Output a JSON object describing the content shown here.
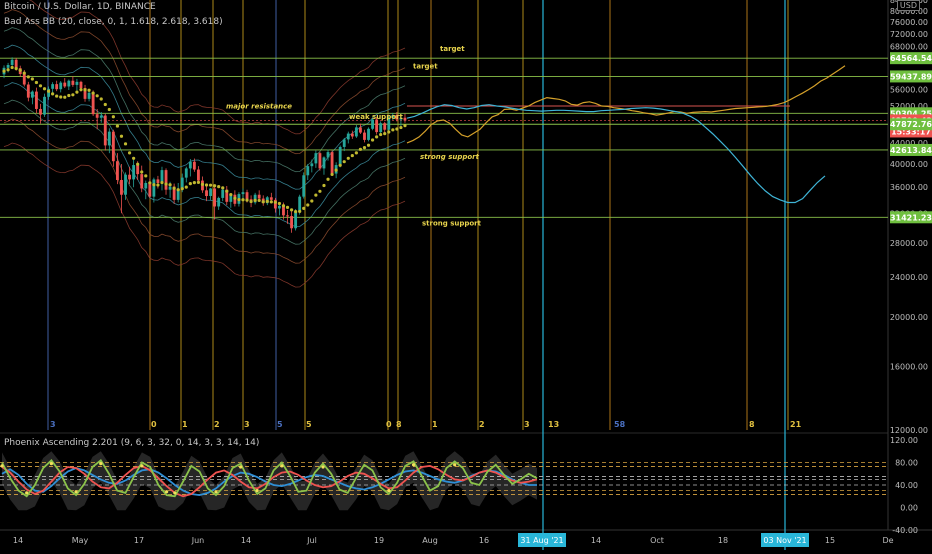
{
  "header": {
    "symbol_line": "Bitcoin / U.S. Dollar, 1D, BINANCE",
    "indicator_line": "Bad Ass BB (20, close, 0, 1, 1.618, 2.618, 3.618)",
    "oscillator_line": "Phoenix Ascending 2.201 (9, 6, 3, 32, 0, 14, 3, 3, 14, 14)",
    "currency": "USD"
  },
  "chart_data": [
    {
      "type": "candlestick",
      "title": "Bitcoin / U.S. Dollar, 1D, BINANCE",
      "ylim": [
        12000,
        84000
      ],
      "scale": "log",
      "grid": false,
      "x_ticks": [
        "14",
        "May",
        "17",
        "Jun",
        "14",
        "Jul",
        "19",
        "Aug",
        "16",
        "31 Aug '21",
        "14",
        "Oct",
        "18",
        "03 Nov '21",
        "15",
        "De"
      ],
      "y_ticks": [
        "84000.00",
        "80000.00",
        "76000.00",
        "72000.00",
        "68000.00",
        "64000.00",
        "60000.00",
        "56000.00",
        "52000.00",
        "48000.00",
        "44000.00",
        "40000.00",
        "36000.00",
        "32000.00",
        "28000.00",
        "24000.00",
        "20000.00",
        "16000.00",
        "12000.00"
      ],
      "price_badges": [
        {
          "value": "64564.54",
          "color": "#6fbf3f"
        },
        {
          "value": "59437.89",
          "color": "#6fbf3f"
        },
        {
          "value": "50304.25",
          "color": "#6fbf3f"
        },
        {
          "value": "48700.42",
          "color": "#ef5350"
        },
        {
          "value": "15:33:17",
          "color": "#ef5350"
        },
        {
          "value": "47872.76",
          "color": "#6fbf3f"
        },
        {
          "value": "42613.84",
          "color": "#6fbf3f"
        },
        {
          "value": "31421.23",
          "color": "#6fbf3f"
        }
      ],
      "horizontal_levels": [
        64564.54,
        59437.89,
        50304.25,
        47872.76,
        42613.84,
        31421.23
      ],
      "resistance_line": 52000,
      "annotations": [
        {
          "text": "target",
          "price": 64564.54
        },
        {
          "text": "target",
          "price": 59437.89
        },
        {
          "text": "major resistance",
          "price": 50304.25
        },
        {
          "text": "weak support",
          "price": 47872.76
        },
        {
          "text": "strong support",
          "price": 42613.84
        },
        {
          "text": "strong support",
          "price": 31421.23
        }
      ],
      "fib_labels": [
        "3",
        "0",
        "1",
        "2",
        "3",
        "5",
        "5",
        "0",
        "8",
        "1",
        "2",
        "3",
        "13",
        "58",
        "8",
        "21"
      ],
      "candles": [
        [
          60000,
          62500,
          59000,
          61800
        ],
        [
          61800,
          63200,
          60500,
          62600
        ],
        [
          62600,
          64800,
          61500,
          64100
        ],
        [
          64100,
          64600,
          61000,
          61700
        ],
        [
          61700,
          62400,
          59300,
          60100
        ],
        [
          60100,
          61200,
          56800,
          57300
        ],
        [
          57300,
          58000,
          53100,
          54000
        ],
        [
          54000,
          55800,
          52400,
          55500
        ],
        [
          55500,
          56500,
          50300,
          51300
        ],
        [
          51300,
          52500,
          48000,
          50000
        ],
        [
          50000,
          55000,
          49500,
          54200
        ],
        [
          54200,
          56800,
          53500,
          56200
        ],
        [
          56200,
          57900,
          55100,
          57400
        ],
        [
          57400,
          58300,
          55600,
          56100
        ],
        [
          56100,
          58200,
          55300,
          57800
        ],
        [
          57800,
          59000,
          56400,
          56800
        ],
        [
          56800,
          58600,
          55900,
          58300
        ],
        [
          58300,
          59500,
          56700,
          57200
        ],
        [
          57200,
          58800,
          55800,
          58000
        ],
        [
          58000,
          58300,
          55500,
          56400
        ],
        [
          56400,
          57200,
          53000,
          53700
        ],
        [
          53700,
          55600,
          53100,
          55200
        ],
        [
          55200,
          55800,
          49700,
          50100
        ],
        [
          50100,
          51300,
          46800,
          49300
        ],
        [
          49300,
          50600,
          48200,
          49800
        ],
        [
          49800,
          50200,
          42500,
          43500
        ],
        [
          43500,
          47000,
          42000,
          46300
        ],
        [
          46300,
          46700,
          39500,
          40500
        ],
        [
          40500,
          42000,
          36500,
          37200
        ],
        [
          37200,
          40000,
          32000,
          34800
        ],
        [
          34800,
          38500,
          34000,
          38100
        ],
        [
          38100,
          39500,
          36500,
          37300
        ],
        [
          37300,
          40800,
          36000,
          39800
        ],
        [
          39800,
          40500,
          37200,
          38200
        ],
        [
          38200,
          39700,
          35200,
          35800
        ],
        [
          35800,
          37100,
          34100,
          36700
        ],
        [
          36700,
          37400,
          34300,
          34500
        ],
        [
          34500,
          37600,
          33600,
          37300
        ],
        [
          37300,
          37900,
          35800,
          36700
        ],
        [
          36700,
          39500,
          35500,
          38900
        ],
        [
          38900,
          39200,
          34800,
          35600
        ],
        [
          35600,
          36900,
          34300,
          36100
        ],
        [
          36100,
          36600,
          33400,
          34000
        ],
        [
          34000,
          36700,
          33600,
          35700
        ],
        [
          35700,
          38300,
          35200,
          37600
        ],
        [
          37600,
          39500,
          36800,
          39200
        ],
        [
          39200,
          40900,
          37800,
          40400
        ],
        [
          40400,
          41000,
          38600,
          39000
        ],
        [
          39000,
          39600,
          36700,
          37100
        ],
        [
          37100,
          37800,
          35100,
          35500
        ],
        [
          35500,
          36400,
          33800,
          34600
        ],
        [
          34600,
          35900,
          34000,
          35800
        ],
        [
          35800,
          36300,
          31100,
          33000
        ],
        [
          33000,
          34500,
          32500,
          34300
        ],
        [
          34300,
          36000,
          33800,
          35600
        ],
        [
          35600,
          36200,
          33200,
          33700
        ],
        [
          33700,
          34900,
          32800,
          34800
        ],
        [
          34800,
          35500,
          33000,
          33400
        ],
        [
          33400,
          35200,
          33000,
          34900
        ],
        [
          34900,
          35800,
          34200,
          35200
        ],
        [
          35200,
          35600,
          33600,
          34100
        ],
        [
          34100,
          34700,
          32900,
          33600
        ],
        [
          33600,
          35100,
          33300,
          34800
        ],
        [
          34800,
          35500,
          33800,
          34200
        ],
        [
          34200,
          34700,
          33100,
          33500
        ],
        [
          33500,
          34600,
          33200,
          34400
        ],
        [
          34400,
          35100,
          33900,
          34000
        ],
        [
          34000,
          34300,
          32100,
          32700
        ],
        [
          32700,
          33400,
          31700,
          33100
        ],
        [
          33100,
          33600,
          31100,
          31700
        ],
        [
          31700,
          32500,
          30500,
          31600
        ],
        [
          31600,
          32300,
          29300,
          29900
        ],
        [
          29900,
          32600,
          29600,
          32200
        ],
        [
          32200,
          34800,
          31800,
          34500
        ],
        [
          34500,
          38500,
          34200,
          38000
        ],
        [
          38000,
          40000,
          37200,
          39600
        ],
        [
          39600,
          40800,
          38500,
          40100
        ],
        [
          40100,
          42500,
          39300,
          42000
        ],
        [
          42000,
          42300,
          38800,
          39200
        ],
        [
          39200,
          41400,
          38100,
          41200
        ],
        [
          41200,
          42700,
          40600,
          42200
        ],
        [
          42200,
          42500,
          37900,
          38300
        ],
        [
          38300,
          40300,
          37500,
          39800
        ],
        [
          39800,
          43500,
          39400,
          43200
        ],
        [
          43200,
          45000,
          42400,
          44700
        ],
        [
          44700,
          46300,
          43900,
          45900
        ],
        [
          45900,
          46500,
          44800,
          45300
        ],
        [
          45300,
          47700,
          45000,
          47200
        ],
        [
          47200,
          48000,
          45800,
          46100
        ],
        [
          46100,
          46700,
          44100,
          44600
        ],
        [
          44600,
          47200,
          44300,
          46900
        ],
        [
          46900,
          49200,
          46600,
          48900
        ],
        [
          48900,
          49500,
          45700,
          46200
        ],
        [
          46200,
          48500,
          45600,
          48100
        ],
        [
          48100,
          48400,
          46000,
          46700
        ],
        [
          46700,
          49800,
          46400,
          49300
        ],
        [
          49300,
          50400,
          48800,
          49900
        ],
        [
          49900,
          50600,
          48500,
          48900
        ],
        [
          48900,
          49800,
          47400,
          49300
        ],
        [
          49300,
          50200,
          48200,
          48700
        ]
      ],
      "series": [
        {
          "name": "",
          "color": "#d4a02a",
          "values": [
            44000,
            44500,
            45200,
            46400,
            47800,
            48600,
            48800,
            48100,
            46800,
            45600,
            45200,
            46000,
            46800,
            48200,
            49500,
            50000,
            51200,
            51300,
            51000,
            51500,
            52000,
            52800,
            53400,
            54000,
            53800,
            53600,
            53200,
            52400,
            52200,
            52800,
            53000,
            52600,
            52000,
            51900,
            51600,
            51400,
            51200,
            50900,
            50700,
            50400,
            50200,
            49900,
            50100,
            50400,
            50700,
            50600,
            50300,
            50500,
            50600,
            50700,
            50600,
            50800,
            51000,
            51200,
            51400,
            51500,
            51600,
            51700,
            51800,
            51900,
            52100,
            52400,
            52800,
            53500,
            54300,
            55100,
            56000,
            57000,
            58200,
            59000,
            60100,
            61200,
            62400
          ]
        },
        {
          "name": "",
          "color": "#3fb4d6",
          "values": [
            49200,
            49600,
            50300,
            51100,
            51800,
            52300,
            52100,
            51600,
            51300,
            51600,
            52100,
            52300,
            52000,
            51800,
            51500,
            51200,
            51000,
            50900,
            50800,
            50900,
            51000,
            51000,
            50900,
            50800,
            50700,
            50700,
            50900,
            51000,
            51100,
            51200,
            51400,
            51500,
            51600,
            51500,
            51300,
            51000,
            50700,
            50300,
            49600,
            48600,
            47200,
            45800,
            44300,
            42800,
            41200,
            39600,
            38000,
            36600,
            35400,
            34500,
            34000,
            33600,
            33600,
            34200,
            35500,
            36800,
            37900
          ]
        }
      ],
      "vertical_lines_blue": [
        "31 Aug '21",
        "03 Nov '21"
      ]
    },
    {
      "type": "line",
      "title": "Phoenix Ascending 2.201 (9, 6, 3, 32, 0, 14, 3, 3, 14, 14)",
      "ylim": [
        -40,
        120
      ],
      "y_ticks": [
        "120.00",
        "80.00",
        "40.00",
        "0.00",
        "-40.00"
      ],
      "levels": [
        80,
        73,
        55,
        50,
        40,
        30,
        23
      ],
      "series": [
        {
          "name": "",
          "color": "#2f8fd6",
          "values": [
            60,
            68,
            58,
            42,
            30,
            28,
            38,
            52,
            64,
            70,
            66,
            58,
            50,
            44,
            42,
            48,
            58,
            66,
            68,
            62,
            52,
            40,
            30,
            24,
            22,
            26,
            34,
            46,
            56,
            62,
            60,
            54,
            46,
            40,
            38,
            42,
            48,
            54,
            58,
            56,
            50,
            44,
            38,
            34,
            32,
            36,
            42,
            50,
            58,
            64,
            66,
            62,
            56,
            50,
            46,
            44,
            48,
            56,
            62,
            66,
            64,
            58,
            50,
            44,
            40,
            40
          ]
        },
        {
          "name": "",
          "color": "#ef5350",
          "values": [
            72,
            62,
            46,
            32,
            24,
            30,
            46,
            62,
            72,
            70,
            60,
            46,
            36,
            34,
            44,
            58,
            70,
            74,
            66,
            52,
            38,
            26,
            20,
            24,
            36,
            50,
            62,
            66,
            58,
            46,
            36,
            34,
            42,
            54,
            62,
            64,
            58,
            48,
            40,
            36,
            38,
            46,
            56,
            62,
            60,
            52,
            42,
            34,
            36,
            48,
            62,
            72,
            74,
            68,
            58,
            50,
            48,
            54,
            62,
            66,
            62,
            54,
            48,
            44,
            46,
            50
          ]
        },
        {
          "name": "",
          "color": "#8bc34a",
          "values": [
            80,
            52,
            30,
            20,
            40,
            70,
            84,
            64,
            34,
            22,
            42,
            72,
            84,
            60,
            30,
            26,
            54,
            80,
            72,
            40,
            22,
            20,
            46,
            74,
            64,
            34,
            22,
            38,
            70,
            78,
            48,
            24,
            34,
            66,
            80,
            56,
            28,
            30,
            62,
            78,
            60,
            32,
            26,
            52,
            76,
            66,
            36,
            24,
            44,
            74,
            82,
            56,
            30,
            38,
            70,
            82,
            70,
            44,
            40,
            64,
            76,
            58,
            42,
            50,
            60,
            52
          ]
        }
      ]
    }
  ]
}
